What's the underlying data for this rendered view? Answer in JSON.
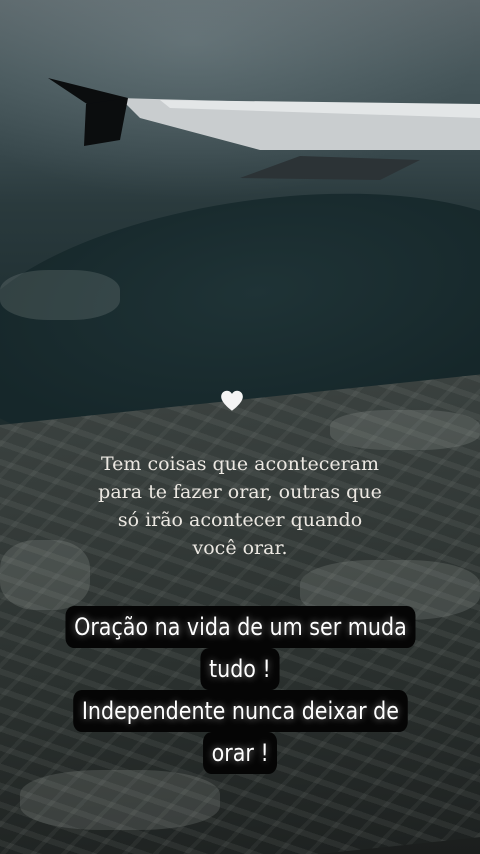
{
  "quote": {
    "lines": [
      "Tem coisas que aconteceram",
      "para te fazer orar, outras que",
      "só irão acontecer quando",
      "você orar."
    ]
  },
  "caption": {
    "lines": [
      "Oração na vida de um ser muda",
      "tudo !",
      "Independente nunca deixar de",
      "orar !"
    ]
  },
  "colors": {
    "quote_text": "#ece8e2",
    "caption_text": "#ffffff",
    "caption_background": "#050505"
  },
  "icons": {
    "heart": "heart-icon"
  }
}
